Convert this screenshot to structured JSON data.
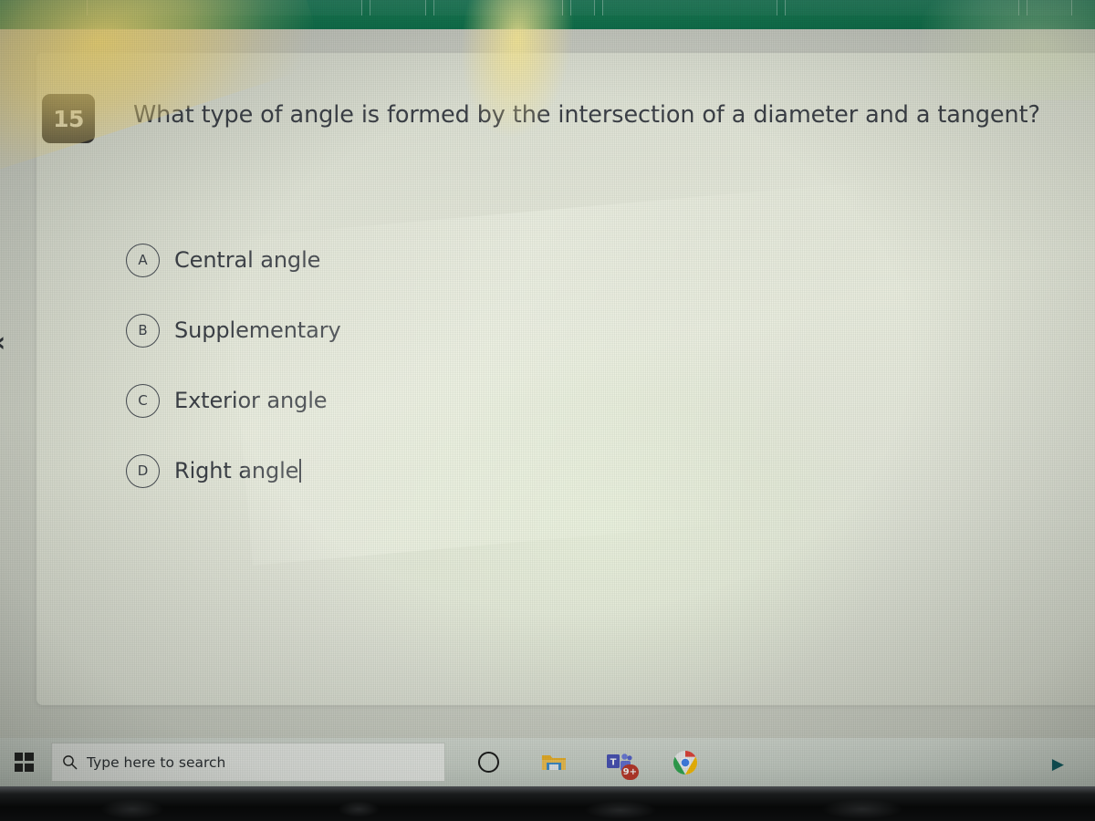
{
  "browser": {
    "tabs_visible": 8
  },
  "quiz": {
    "question_number": "15",
    "question_text": "What type of angle is formed by the intersection of a diameter and a tangent?",
    "options": [
      {
        "letter": "A",
        "label": "Central angle"
      },
      {
        "letter": "B",
        "label": "Supplementary"
      },
      {
        "letter": "C",
        "label": "Exterior angle"
      },
      {
        "letter": "D",
        "label": "Right angle"
      }
    ],
    "caret_after_option": "D",
    "back_arrow": "‹"
  },
  "taskbar": {
    "start_name": "windows-start",
    "search_placeholder": "Type here to search",
    "search_icon": "search-icon",
    "icons": [
      {
        "name": "cortana-icon",
        "label": "Cortana"
      },
      {
        "name": "file-explorer-icon",
        "label": "File Explorer"
      },
      {
        "name": "microsoft-teams-icon",
        "label": "Microsoft Teams",
        "badge": "9+"
      },
      {
        "name": "google-chrome-icon",
        "label": "Google Chrome"
      }
    ],
    "tray_arrow": "▶"
  },
  "colors": {
    "browser_green": "#13754f",
    "number_badge_bg": "#393733",
    "text": "#3d4148",
    "teams_badge": "#c0392b",
    "tray_arrow": "#0f5c63"
  }
}
